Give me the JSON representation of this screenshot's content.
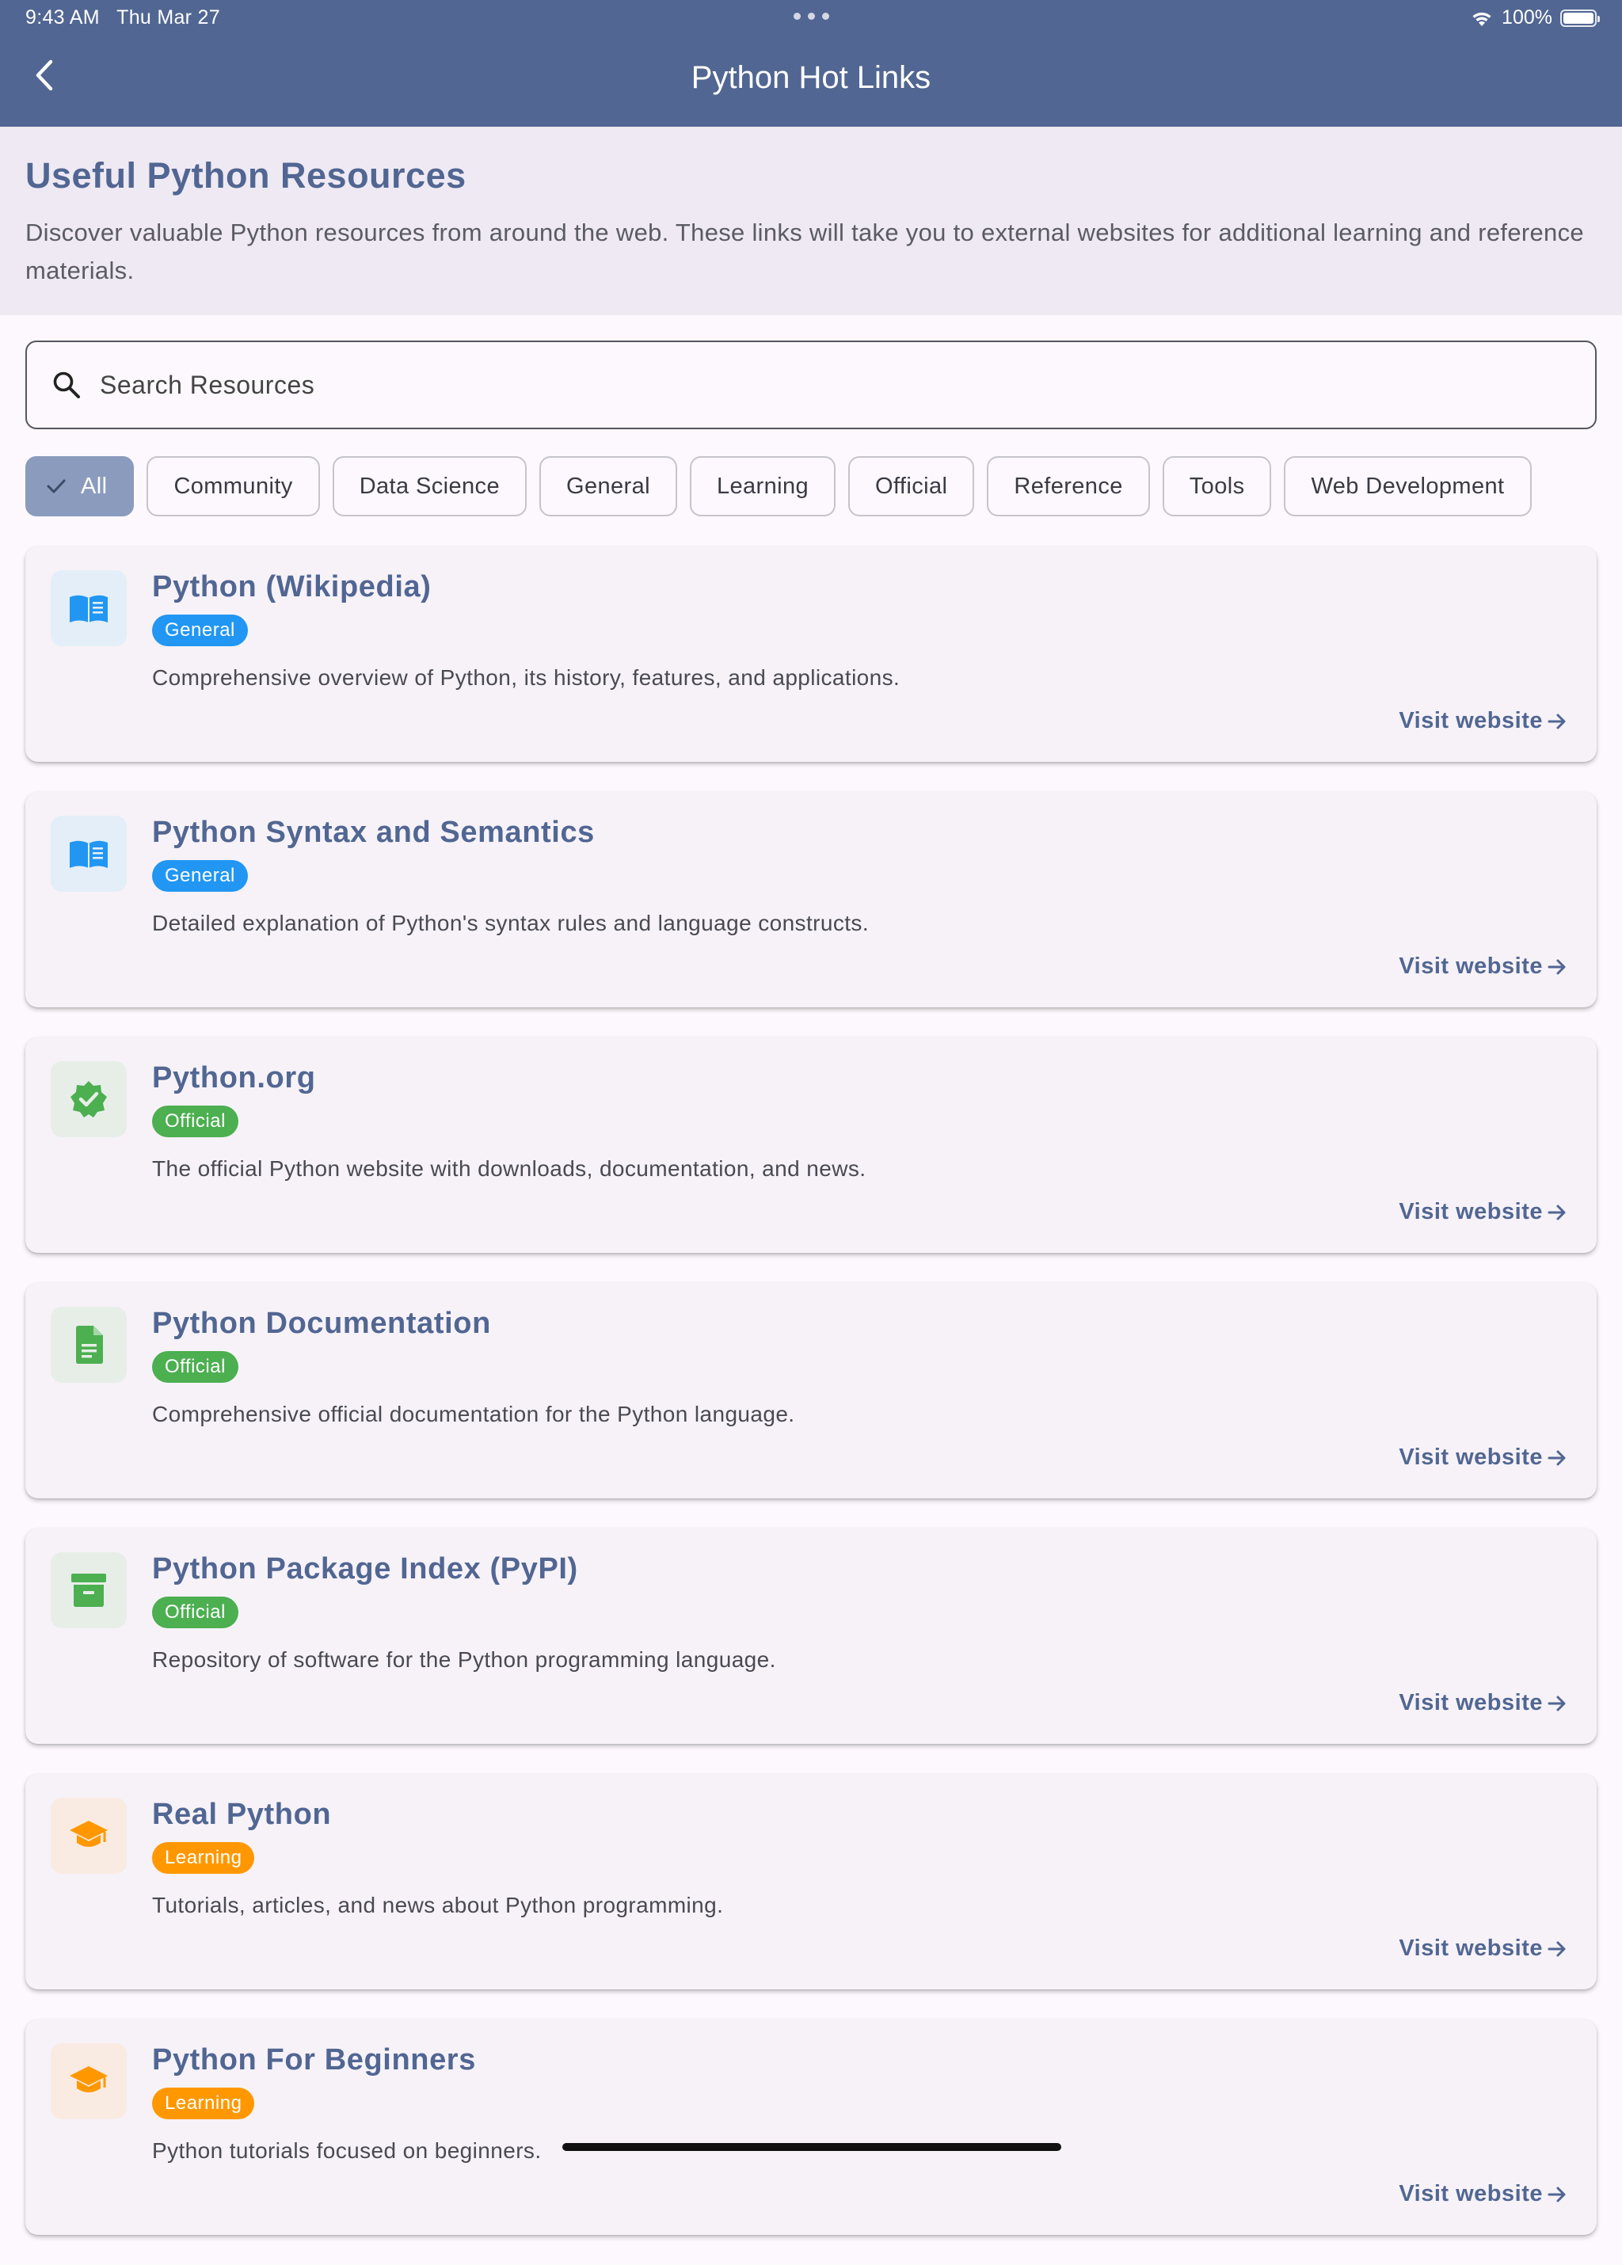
{
  "status_bar": {
    "time": "9:43 AM",
    "date": "Thu Mar 27",
    "battery": "100%"
  },
  "app_bar": {
    "title": "Python Hot Links"
  },
  "intro": {
    "heading": "Useful Python Resources",
    "description": "Discover valuable Python resources from around the web. These links will take you to external websites for additional learning and reference materials."
  },
  "search": {
    "placeholder": "Search Resources",
    "value": ""
  },
  "filters": [
    {
      "label": "All",
      "selected": true
    },
    {
      "label": "Community",
      "selected": false
    },
    {
      "label": "Data Science",
      "selected": false
    },
    {
      "label": "General",
      "selected": false
    },
    {
      "label": "Learning",
      "selected": false
    },
    {
      "label": "Official",
      "selected": false
    },
    {
      "label": "Reference",
      "selected": false
    },
    {
      "label": "Tools",
      "selected": false
    },
    {
      "label": "Web Development",
      "selected": false
    }
  ],
  "resources": [
    {
      "title": "Python (Wikipedia)",
      "category": "General",
      "description": "Comprehensive overview of Python, its history, features, and applications.",
      "link_label": "Visit website",
      "icon": "book-icon"
    },
    {
      "title": "Python Syntax and Semantics",
      "category": "General",
      "description": "Detailed explanation of Python's syntax rules and language constructs.",
      "link_label": "Visit website",
      "icon": "book-icon"
    },
    {
      "title": "Python.org",
      "category": "Official",
      "description": "The official Python website with downloads, documentation, and news.",
      "link_label": "Visit website",
      "icon": "verified-icon"
    },
    {
      "title": "Python Documentation",
      "category": "Official",
      "description": "Comprehensive official documentation for the Python language.",
      "link_label": "Visit website",
      "icon": "document-icon"
    },
    {
      "title": "Python Package Index (PyPI)",
      "category": "Official",
      "description": "Repository of software for the Python programming language.",
      "link_label": "Visit website",
      "icon": "archive-icon"
    },
    {
      "title": "Real Python",
      "category": "Learning",
      "description": "Tutorials, articles, and news about Python programming.",
      "link_label": "Visit website",
      "icon": "graduation-cap-icon"
    },
    {
      "title": "Python For Beginners",
      "category": "Learning",
      "description": "Python tutorials focused on beginners.",
      "link_label": "Visit website",
      "icon": "graduation-cap-icon"
    }
  ],
  "colors": {
    "primary": "#516692",
    "general": "#2196f3",
    "official": "#4caf50",
    "learning": "#ff9800",
    "general_bg": "#e3eef8",
    "official_bg": "#e7eee8",
    "learning_bg": "#f9ebe2"
  }
}
